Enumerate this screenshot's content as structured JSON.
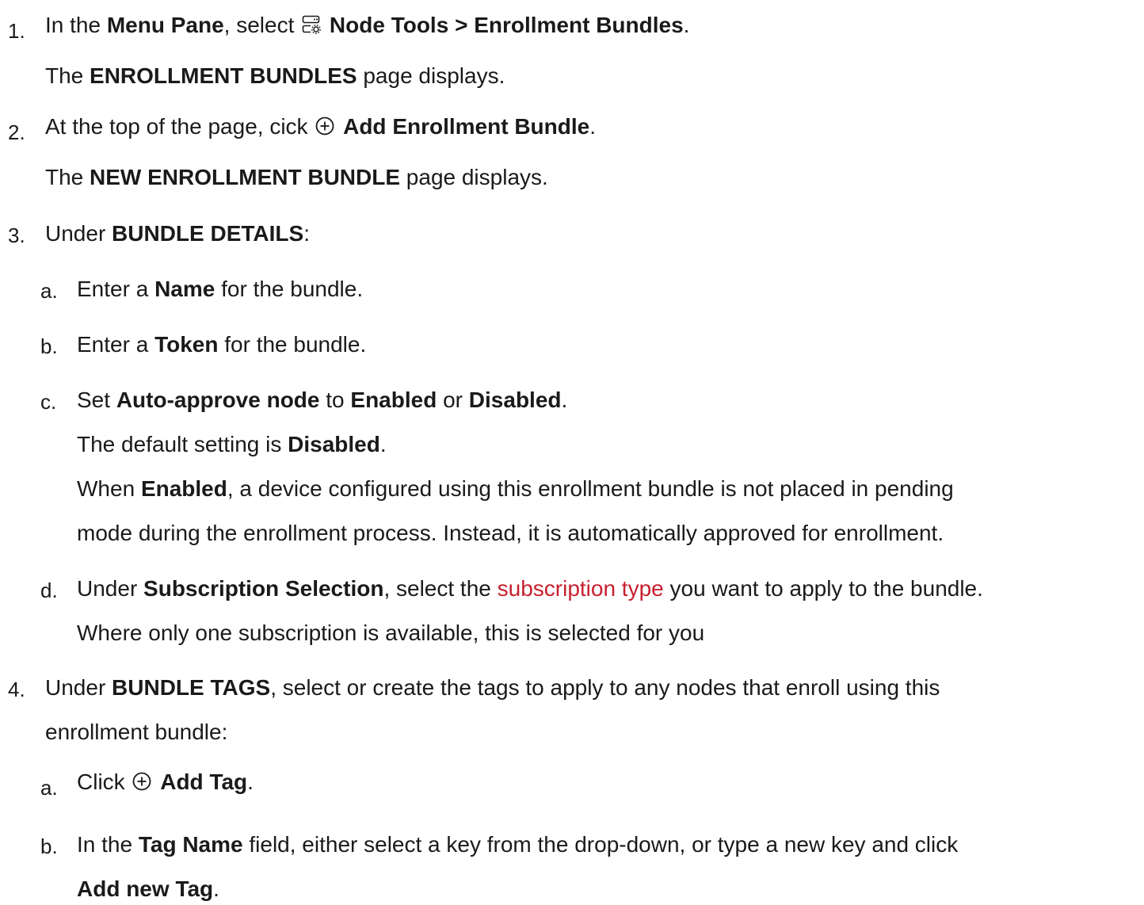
{
  "steps": [
    {
      "number": "1.",
      "line1": {
        "t1": "In the ",
        "b1": "Menu Pane",
        "t2": ", select ",
        "icon": "node-tools-icon",
        "b2": "Node Tools > Enrollment Bundles",
        "t3": "."
      },
      "line2": {
        "t1": "The ",
        "b1": "ENROLLMENT BUNDLES",
        "t2": " page displays."
      }
    },
    {
      "number": "2.",
      "line1": {
        "t1": "At the top of the page, cick ",
        "icon": "add-circle-icon",
        "b1": "Add Enrollment Bundle",
        "t2": "."
      },
      "line2": {
        "t1": "The ",
        "b1": "NEW ENROLLMENT BUNDLE",
        "t2": " page displays."
      }
    },
    {
      "number": "3.",
      "line1": {
        "t1": "Under ",
        "b1": "BUNDLE DETAILS",
        "t2": ":"
      },
      "sub": [
        {
          "letter": "a.",
          "t1": "Enter a ",
          "b1": "Name",
          "t2": " for the bundle."
        },
        {
          "letter": "b.",
          "t1": "Enter a ",
          "b1": "Token",
          "t2": " for the bundle."
        },
        {
          "letter": "c.",
          "t1": "Set ",
          "b1": "Auto-approve node",
          "t2": " to ",
          "b2": "Enabled",
          "t3": " or ",
          "b3": "Disabled",
          "t4": ".",
          "p2_t1": "The default setting is ",
          "p2_b1": "Disabled",
          "p2_t2": ".",
          "p3_t1": "When ",
          "p3_b1": "Enabled",
          "p3_t2": ", a device configured using this enrollment bundle is not placed in pending",
          "p3_line2": "mode during the enrollment process. Instead, it is automatically approved for enrollment."
        },
        {
          "letter": "d.",
          "t1": "Under ",
          "b1": "Subscription Selection",
          "t2": ", select the ",
          "link": "subscription type",
          "t3": " you want to apply to the bundle.",
          "line2": "Where only one subscription is available, this is selected for you"
        }
      ]
    },
    {
      "number": "4.",
      "line1": {
        "t1": "Under ",
        "b1": "BUNDLE TAGS",
        "t2": ", select or create the tags to apply to any nodes that enroll using this"
      },
      "line2": "enrollment bundle:",
      "sub": [
        {
          "letter": "a.",
          "t1": "Click ",
          "icon": "add-circle-icon",
          "b1": "Add Tag",
          "t2": "."
        },
        {
          "letter": "b.",
          "t1": "In the ",
          "b1": "Tag Name",
          "t2": " field, either select a key from the drop-down, or type a new key and click",
          "line2_b": "Add new Tag",
          "line2_t": "."
        }
      ]
    }
  ],
  "colors": {
    "text": "#1a1a1a",
    "link": "#c8202f"
  }
}
